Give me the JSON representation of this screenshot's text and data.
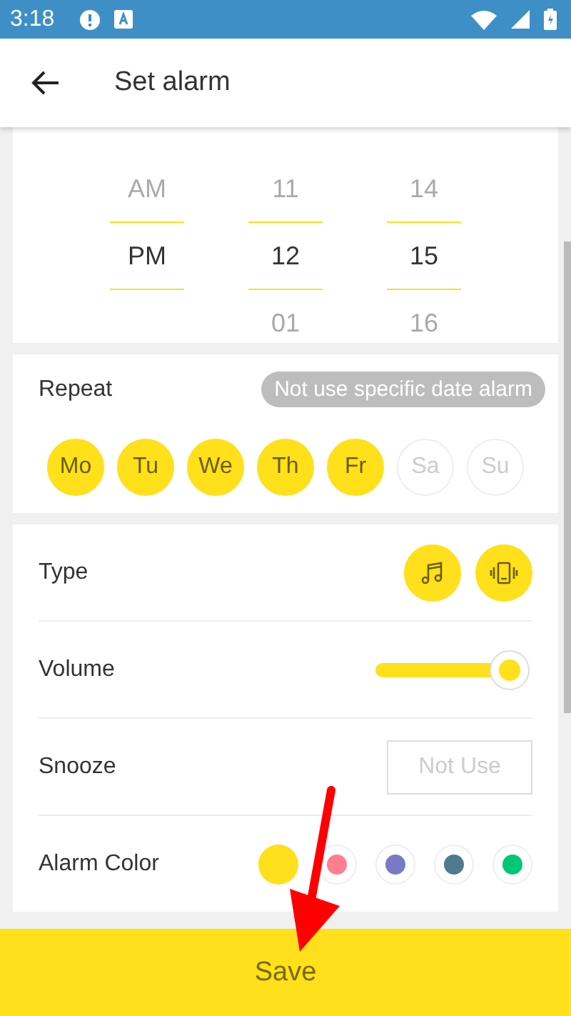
{
  "status_bar": {
    "time": "3:18"
  },
  "app_bar": {
    "title": "Set alarm"
  },
  "time_picker": {
    "columns": [
      {
        "items": [
          {
            "text": "AM",
            "selected": false
          },
          {
            "text": "PM",
            "selected": true
          }
        ]
      },
      {
        "items": [
          {
            "text": "11",
            "selected": false
          },
          {
            "text": "12",
            "selected": true
          },
          {
            "text": "01",
            "selected": false
          }
        ]
      },
      {
        "items": [
          {
            "text": "14",
            "selected": false
          },
          {
            "text": "15",
            "selected": true
          },
          {
            "text": "16",
            "selected": false
          }
        ]
      }
    ]
  },
  "repeat": {
    "label": "Repeat",
    "hint": "Not use specific date alarm",
    "days": [
      {
        "text": "Mo",
        "selected": true
      },
      {
        "text": "Tu",
        "selected": true
      },
      {
        "text": "We",
        "selected": true
      },
      {
        "text": "Th",
        "selected": true
      },
      {
        "text": "Fr",
        "selected": true
      },
      {
        "text": "Sa",
        "selected": false
      },
      {
        "text": "Su",
        "selected": false
      }
    ]
  },
  "type": {
    "label": "Type",
    "options": [
      {
        "kind": "music",
        "on": true
      },
      {
        "kind": "vibrate",
        "on": true
      }
    ]
  },
  "volume": {
    "label": "Volume",
    "level": 0.87
  },
  "snooze": {
    "label": "Snooze",
    "value": "Not Use"
  },
  "alarm_color": {
    "label": "Alarm Color",
    "swatches": [
      {
        "color": "#ffe01b",
        "selected": true
      },
      {
        "color": "#ff7f8f",
        "selected": false
      },
      {
        "color": "#7a7ac4",
        "selected": false
      },
      {
        "color": "#4f7b8e",
        "selected": false
      },
      {
        "color": "#00c774",
        "selected": false
      }
    ]
  },
  "save_button": {
    "label": "Save"
  }
}
